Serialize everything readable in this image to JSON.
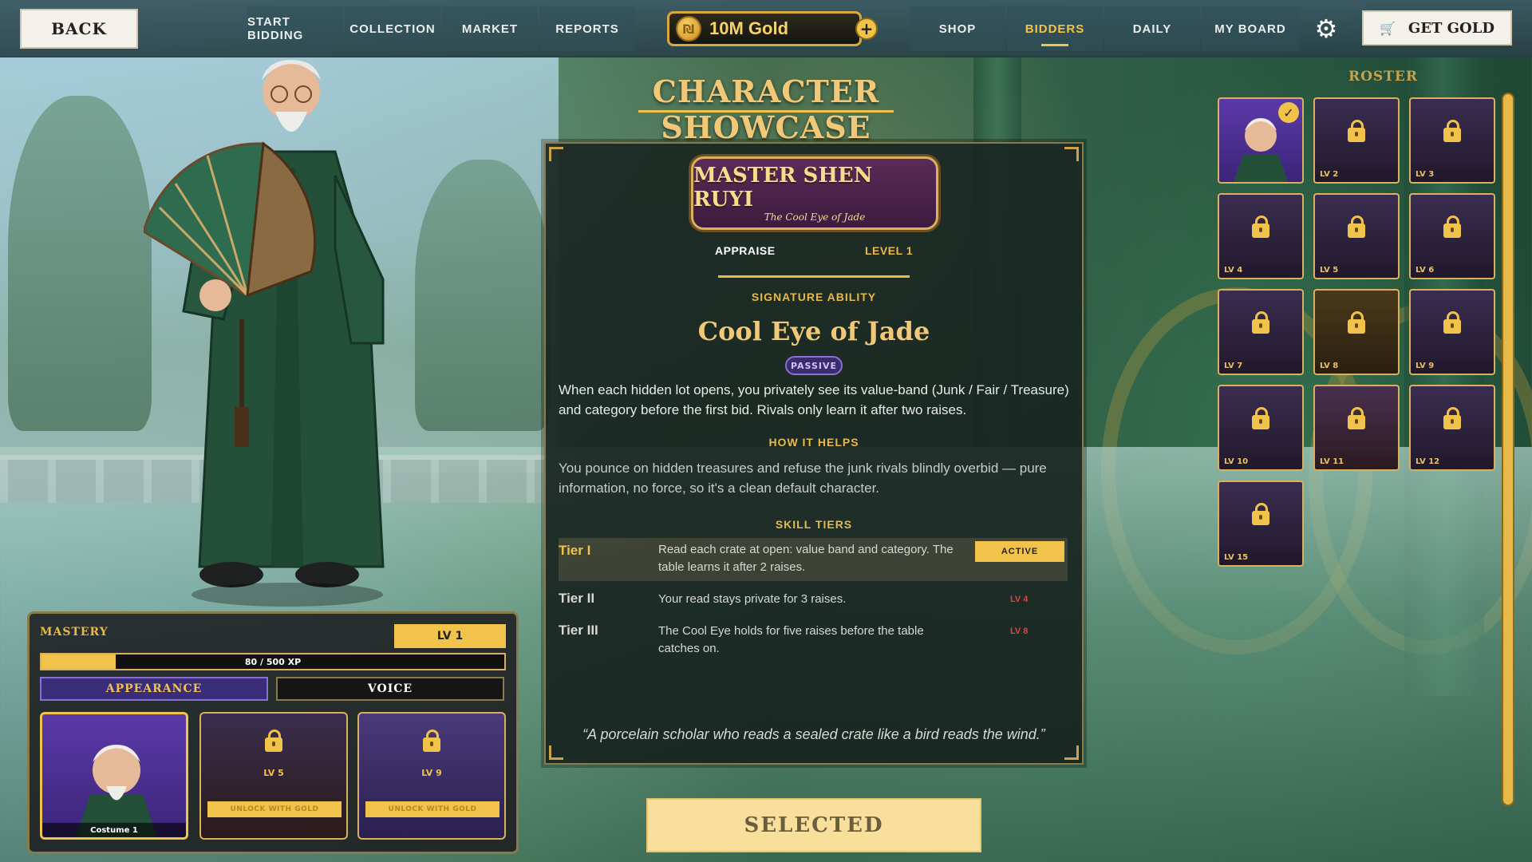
{
  "topbar": {
    "back_label": "BACK",
    "nav_left": [
      "START BIDDING",
      "COLLECTION",
      "MARKET",
      "REPORTS"
    ],
    "gold_amount": "10M Gold",
    "nav_right": [
      "SHOP",
      "BIDDERS",
      "DAILY",
      "MY BOARD"
    ],
    "active_nav": "BIDDERS",
    "get_gold_label": "GET GOLD"
  },
  "showcase": {
    "title": "CHARACTER SHOWCASE",
    "character_name": "MASTER SHEN RUYI",
    "character_epithet": "The Cool Eye of Jade",
    "tabs": {
      "left": "APPRAISE",
      "right": "LEVEL 1"
    },
    "signature_label": "SIGNATURE ABILITY",
    "ability_name": "Cool Eye of Jade",
    "ability_type": "PASSIVE",
    "description": "When each hidden lot opens, you privately see its value-band (Junk / Fair / Treasure) and category before the first bid. Rivals only learn it after two raises.",
    "how_label": "HOW IT HELPS",
    "how_text": "You pounce on hidden treasures and refuse the junk rivals blindly overbid — pure information, no force, so it's a clean default character.",
    "tiers_label": "SKILL TIERS",
    "tiers": [
      {
        "name": "Tier I",
        "desc": "Read each crate at open: value band and category. The table learns it after 2 raises.",
        "status": "ACTIVE"
      },
      {
        "name": "Tier II",
        "desc": "Your read stays private for 3 raises.",
        "status": "LV 4"
      },
      {
        "name": "Tier III",
        "desc": "The Cool Eye holds for five raises before the table catches on.",
        "status": "LV 8"
      }
    ],
    "quote": "“A porcelain scholar who reads a sealed crate like a bird reads the wind.”",
    "selected_label": "SELECTED"
  },
  "mastery": {
    "label": "MASTERY",
    "level": "LV 1",
    "xp_text": "80 / 500 XP",
    "xp_fraction": 0.16,
    "tabs": [
      "APPEARANCE",
      "VOICE"
    ],
    "costumes": [
      {
        "name": "Costume 1",
        "locked": false
      },
      {
        "level": "LV 5",
        "unlock": "UNLOCK WITH GOLD",
        "locked": true
      },
      {
        "level": "LV 9",
        "unlock": "UNLOCK WITH GOLD",
        "locked": true
      }
    ]
  },
  "roster": {
    "title": "ROSTER",
    "slots": [
      "",
      "LV 2",
      "LV 3",
      "LV 4",
      "LV 5",
      "LV 6",
      "LV 7",
      "LV 8",
      "LV 9",
      "LV 10",
      "LV 11",
      "LV 12",
      "LV 15"
    ]
  },
  "colors": {
    "accent": "#f1c34a",
    "panel": "#1d2a26",
    "passive": "#8b6fd6",
    "locked_level": "#e0463c"
  }
}
